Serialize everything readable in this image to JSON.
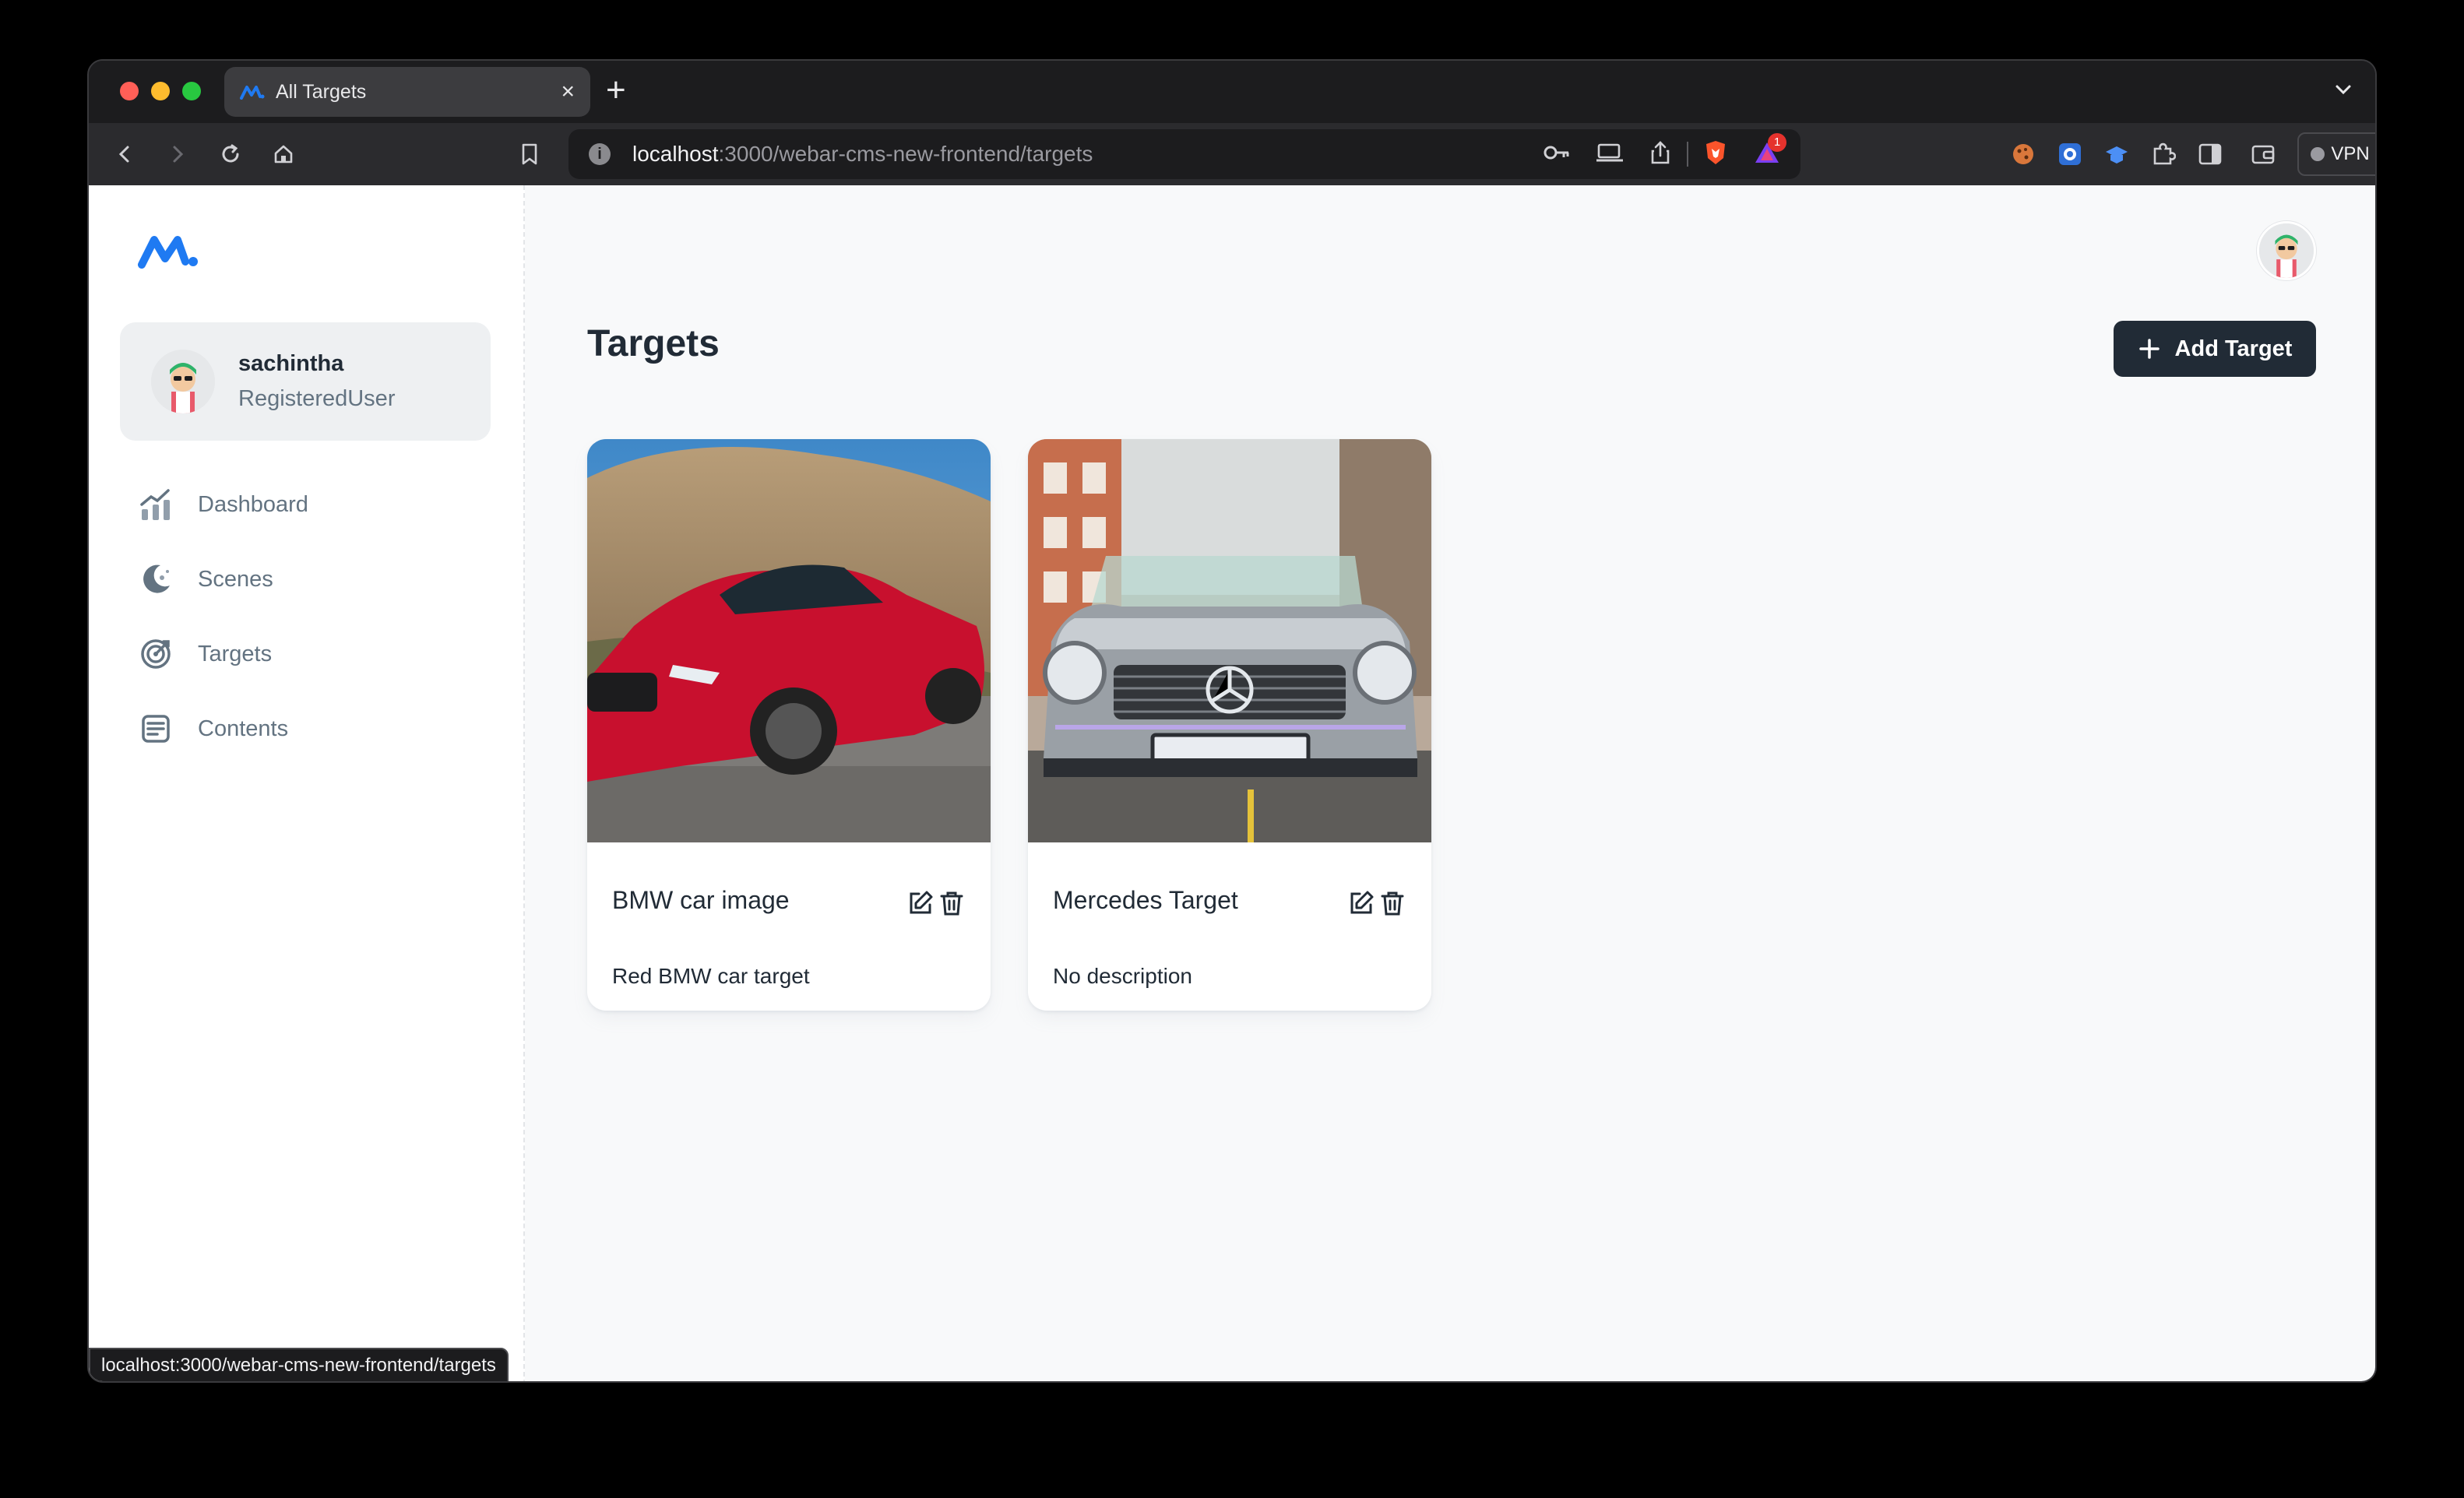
{
  "browser": {
    "tab_title": "All Targets",
    "url_host": "localhost",
    "url_path": ":3000/webar-cms-new-frontend/targets",
    "brave_badge": "1",
    "vpn_label": "VPN",
    "status_url": "localhost:3000/webar-cms-new-frontend/targets"
  },
  "sidebar": {
    "user": {
      "name": "sachintha",
      "role": "RegisteredUser"
    },
    "items": [
      {
        "label": "Dashboard",
        "icon": "chart-icon"
      },
      {
        "label": "Scenes",
        "icon": "moon-icon"
      },
      {
        "label": "Targets",
        "icon": "target-icon"
      },
      {
        "label": "Contents",
        "icon": "contents-icon"
      }
    ]
  },
  "main": {
    "title": "Targets",
    "add_button_label": "Add Target",
    "cards": [
      {
        "title": "BMW car image",
        "description": "Red BMW car target",
        "image": "red-bmw-car-photo"
      },
      {
        "title": "Mercedes Target",
        "description": "No description",
        "image": "silver-mercedes-car-photo"
      }
    ]
  },
  "colors": {
    "accent": "#212b36",
    "logo_blue": "#1f7af2",
    "text_secondary": "#637381",
    "page_bg": "#f8f9fa"
  }
}
